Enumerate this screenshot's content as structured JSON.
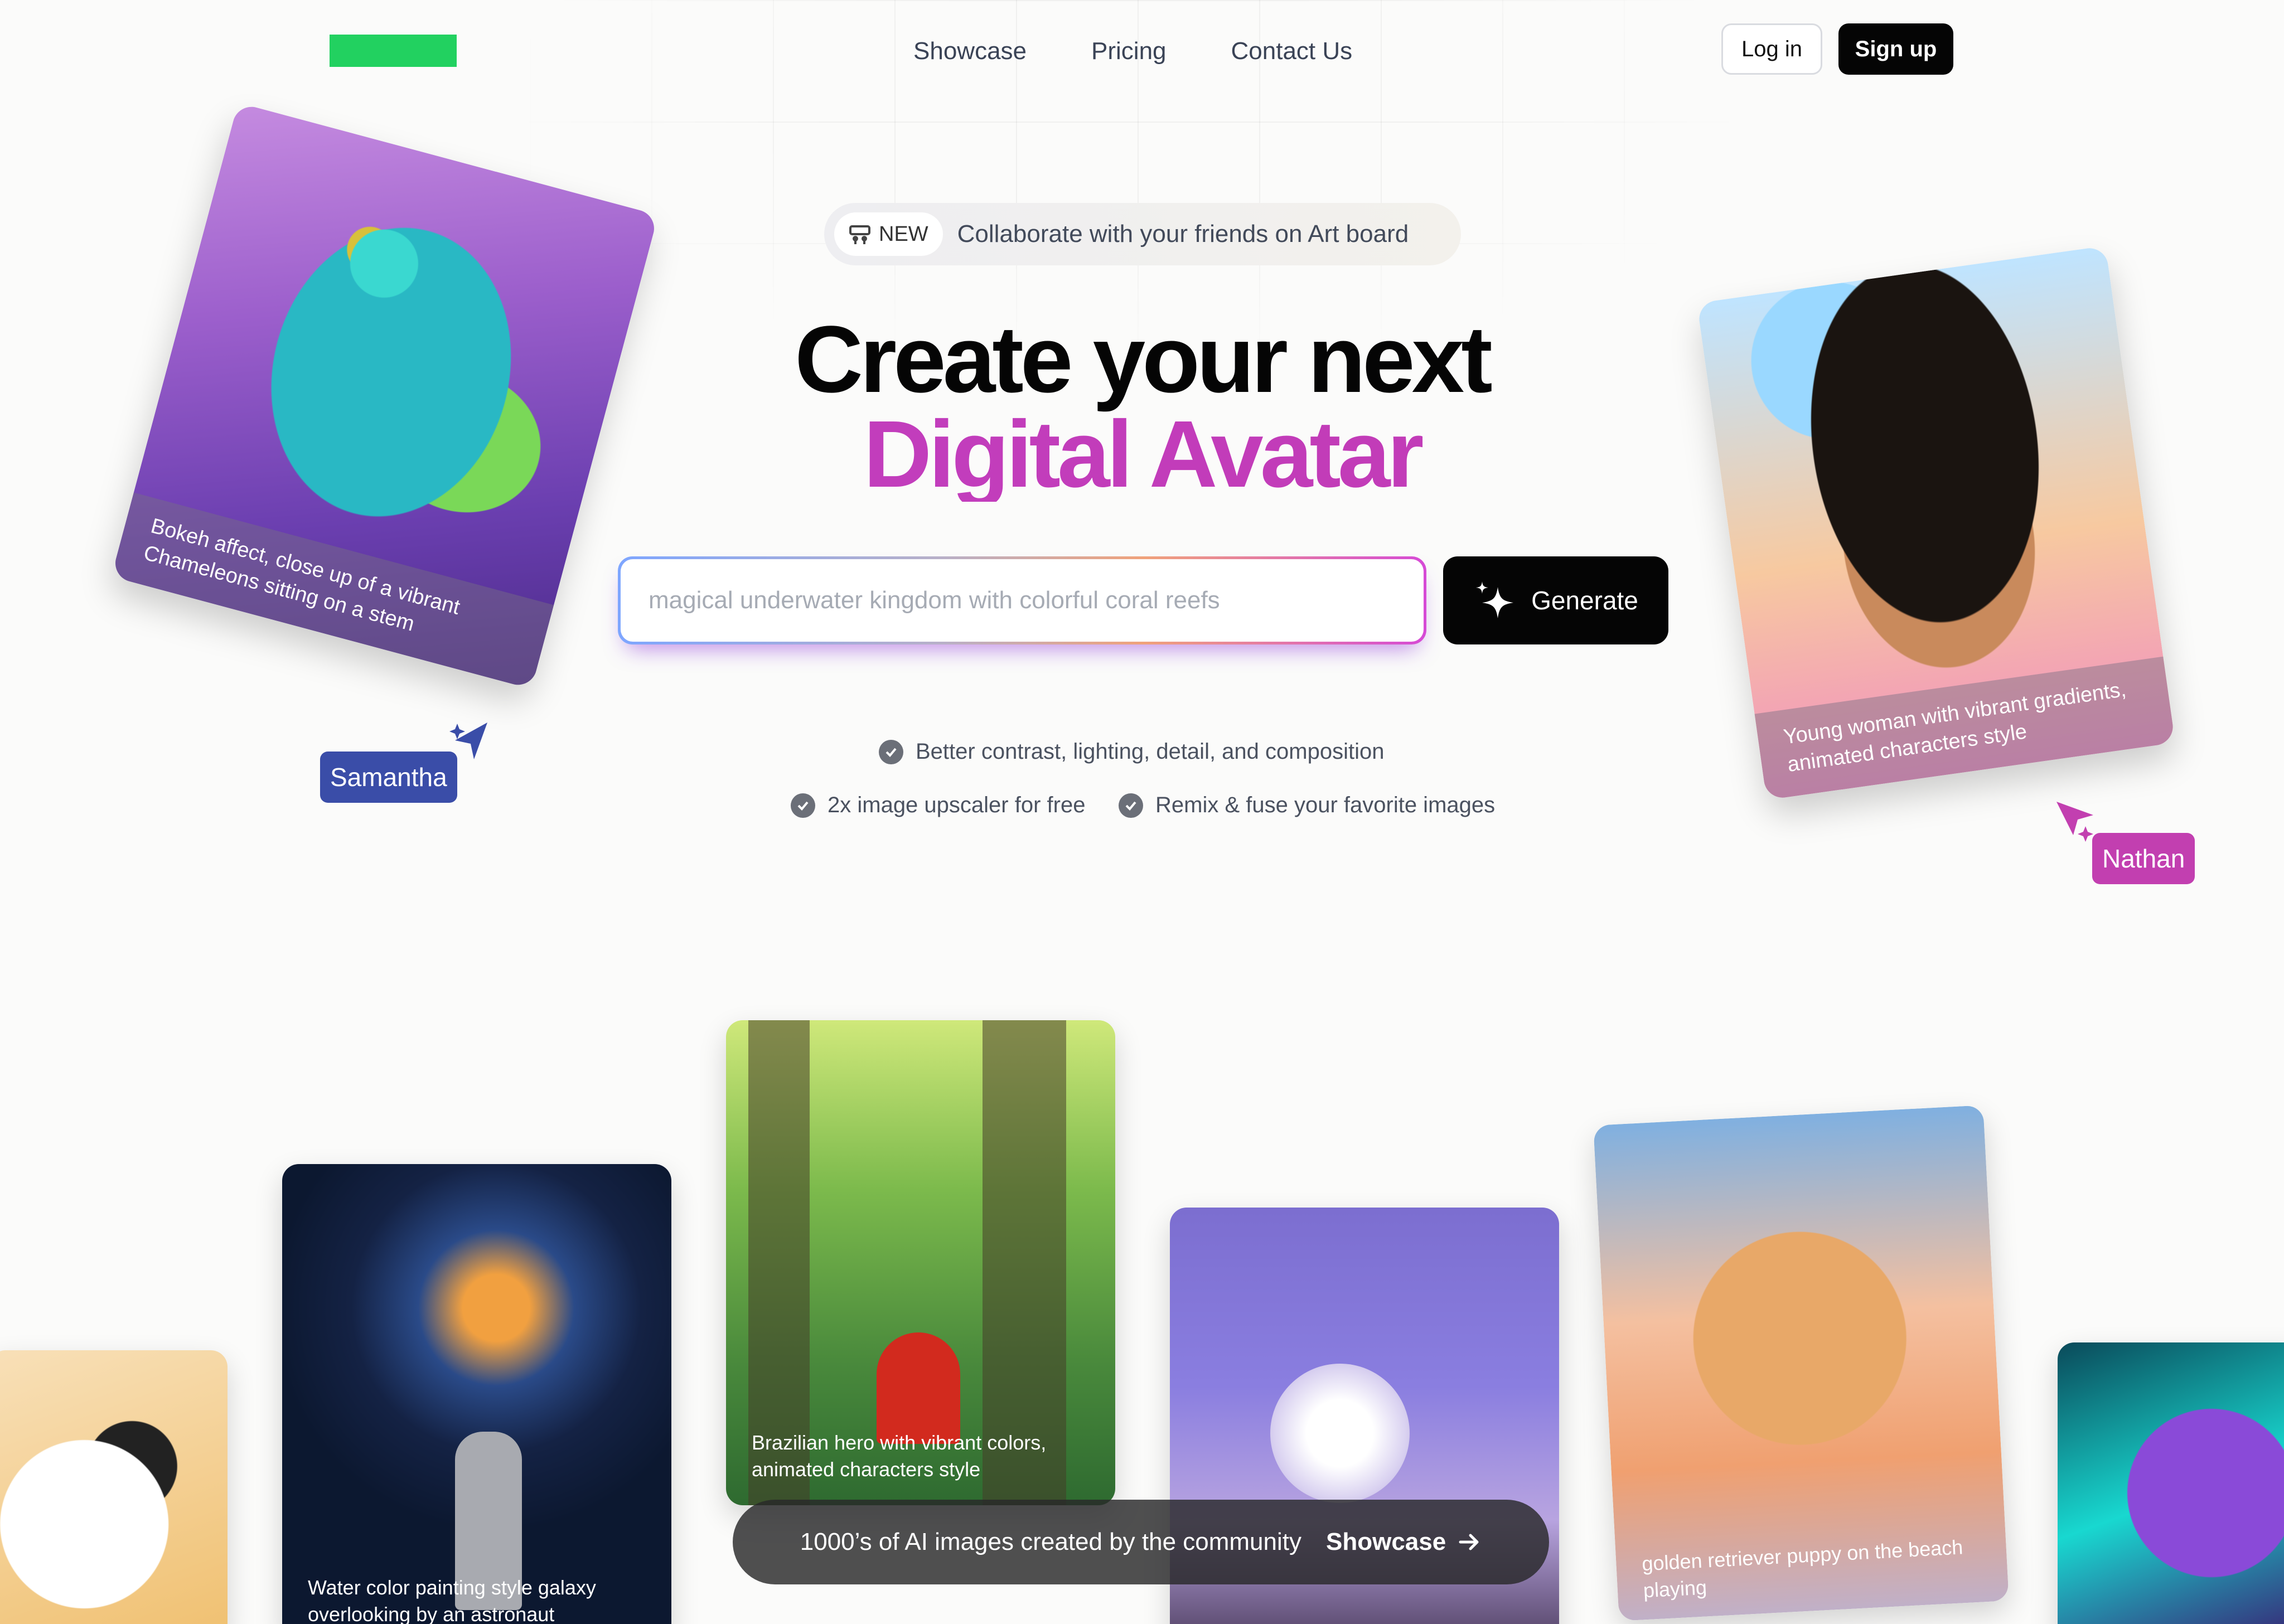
{
  "nav": {
    "links": [
      "Showcase",
      "Pricing",
      "Contact Us"
    ],
    "login": "Log in",
    "signup": "Sign up"
  },
  "announcement": {
    "badge": "NEW",
    "text": "Collaborate with your friends on Art board"
  },
  "hero": {
    "line1": "Create your next",
    "line2": "Digital Avatar"
  },
  "prompt": {
    "placeholder": "magical underwater kingdom with colorful coral reefs",
    "button": "Generate"
  },
  "features": [
    "Better contrast, lighting, detail, and composition",
    "2x image upscaler for free",
    "Remix & fuse your favorite images"
  ],
  "floating_cards": [
    {
      "caption": "Bokeh affect, close up of a vibrant Chameleons sitting on a stem",
      "user": "Samantha"
    },
    {
      "caption": "Young woman with vibrant gradients, animated characters style",
      "user": "Nathan"
    }
  ],
  "gallery": [
    {
      "caption": "Water color painting style galaxy overlooking by an astronaut"
    },
    {
      "caption": "Brazilian hero with vibrant colors, animated characters style"
    },
    {
      "caption": "golden retriever puppy on the beach playing"
    }
  ],
  "community": {
    "text": "1000’s of AI images created by the community",
    "cta": "Showcase"
  },
  "colors": {
    "accent": "#c23cbc",
    "logo": "#22d160",
    "samantha_tag": "#3a4da8",
    "nathan_tag": "#c23fb0"
  }
}
